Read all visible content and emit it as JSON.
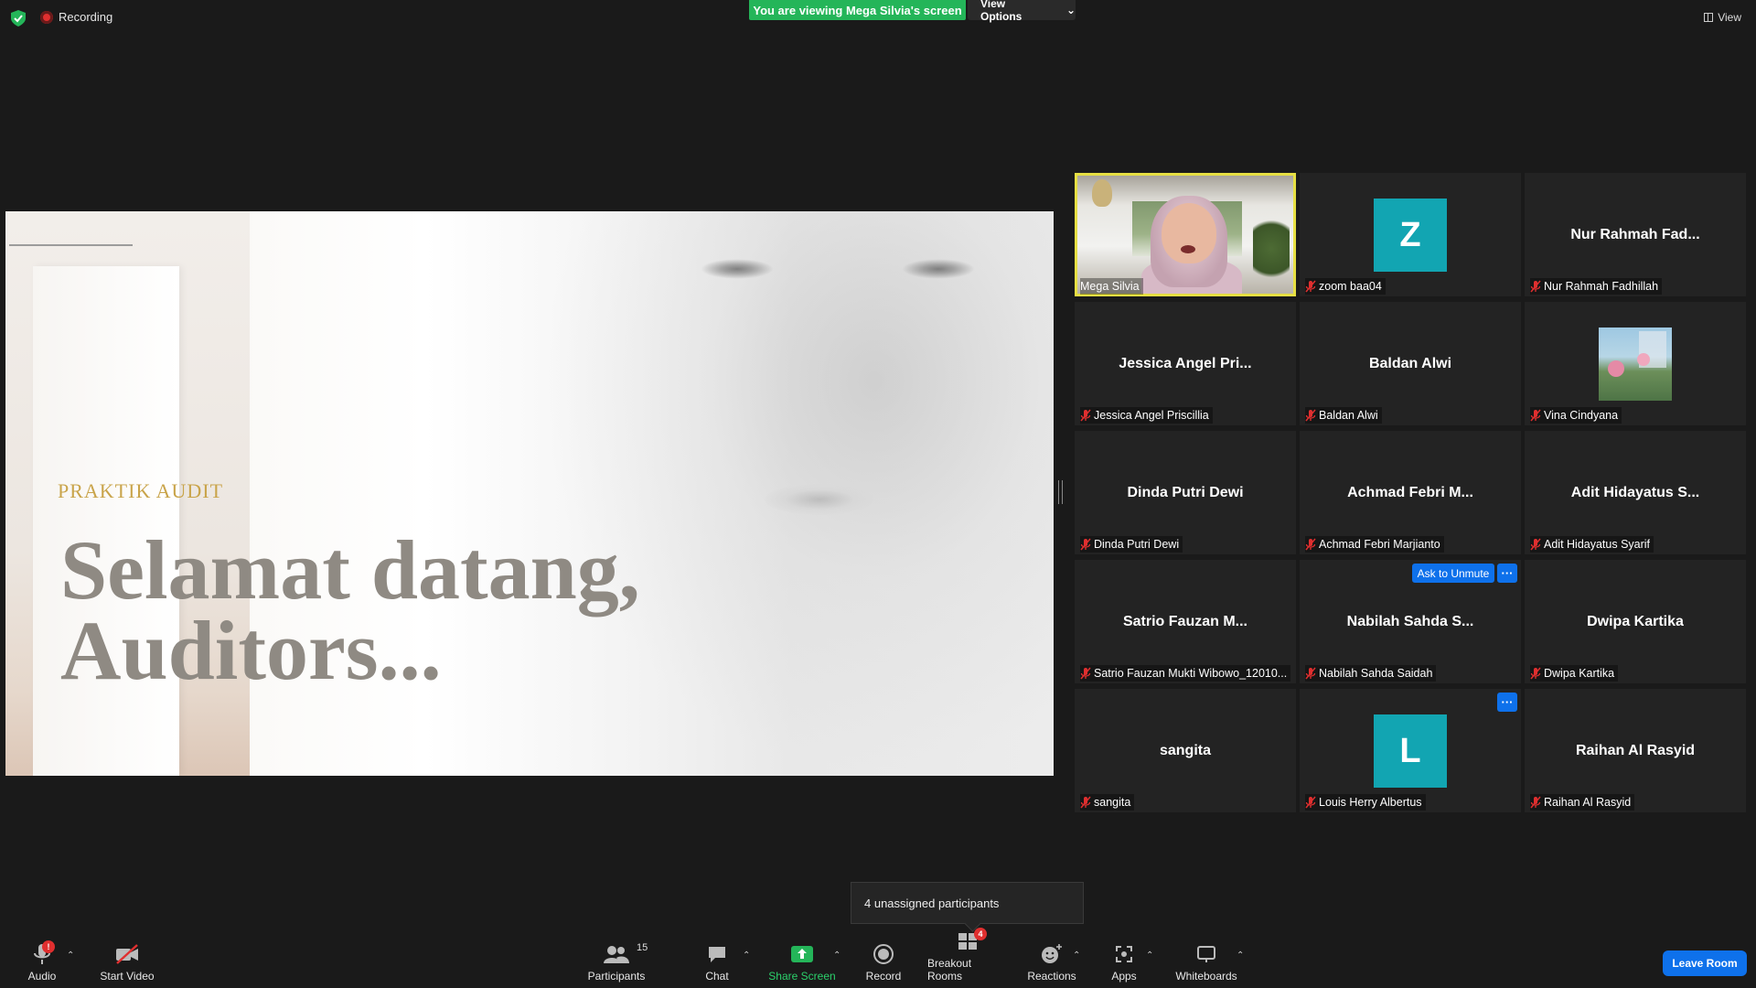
{
  "topbar": {
    "recording_label": "Recording",
    "viewing_banner": "You are viewing Mega Silvia's screen",
    "view_options_label": "View Options",
    "view_label": "View"
  },
  "slide": {
    "kicker": "PRAKTIK AUDIT",
    "title_line1": "Selamat datang,",
    "title_line2": "Auditors..."
  },
  "tiles": [
    {
      "center": "",
      "label": "Mega Silvia",
      "type": "video",
      "active": true,
      "muted": false
    },
    {
      "center": "",
      "label": "zoom baa04",
      "type": "avatar",
      "avatar_letter": "Z",
      "muted": true
    },
    {
      "center": "Nur Rahmah Fad...",
      "label": "Nur Rahmah Fadhillah",
      "type": "name",
      "muted": true
    },
    {
      "center": "Jessica Angel Pri...",
      "label": "Jessica Angel Priscillia",
      "type": "name",
      "muted": true
    },
    {
      "center": "Baldan Alwi",
      "label": "Baldan Alwi",
      "type": "name",
      "muted": true
    },
    {
      "center": "",
      "label": "Vina Cindyana",
      "type": "photo",
      "muted": true
    },
    {
      "center": "Dinda Putri Dewi",
      "label": "Dinda Putri Dewi",
      "type": "name",
      "muted": true
    },
    {
      "center": "Achmad Febri M...",
      "label": "Achmad Febri Marjianto",
      "type": "name",
      "muted": true
    },
    {
      "center": "Adit Hidayatus S...",
      "label": "Adit Hidayatus Syarif",
      "type": "name",
      "muted": true
    },
    {
      "center": "Satrio Fauzan M...",
      "label": "Satrio Fauzan Mukti Wibowo_12010...",
      "type": "name",
      "muted": true
    },
    {
      "center": "Nabilah Sahda S...",
      "label": "Nabilah Sahda Saidah",
      "type": "name",
      "muted": true
    },
    {
      "center": "Dwipa Kartika",
      "label": "Dwipa Kartika",
      "type": "name",
      "muted": true
    },
    {
      "center": "sangita",
      "label": "sangita",
      "type": "name",
      "muted": true
    },
    {
      "center": "",
      "label": "Louis Herry Albertus",
      "type": "avatar",
      "avatar_letter": "L",
      "muted": true
    },
    {
      "center": "Raihan Al Rasyid",
      "label": "Raihan Al Rasyid",
      "type": "name",
      "muted": true
    }
  ],
  "tile_controls": {
    "ask_to_unmute": "Ask to Unmute",
    "more_glyph": "···"
  },
  "tooltip": {
    "text": "4 unassigned participants"
  },
  "toolbar": {
    "audio": "Audio",
    "start_video": "Start Video",
    "participants": "Participants",
    "participants_count": "15",
    "chat": "Chat",
    "share_screen": "Share Screen",
    "record": "Record",
    "breakout_rooms": "Breakout Rooms",
    "breakout_badge": "4",
    "reactions": "Reactions",
    "apps": "Apps",
    "whiteboards": "Whiteboards",
    "leave_room": "Leave Room",
    "audio_badge": "!"
  },
  "colors": {
    "accent_blue": "#0e71eb",
    "banner_green": "#24b559",
    "active_speaker": "#e6df43",
    "avatar_teal": "#12a5b2",
    "muted_red": "#e02f2f"
  }
}
